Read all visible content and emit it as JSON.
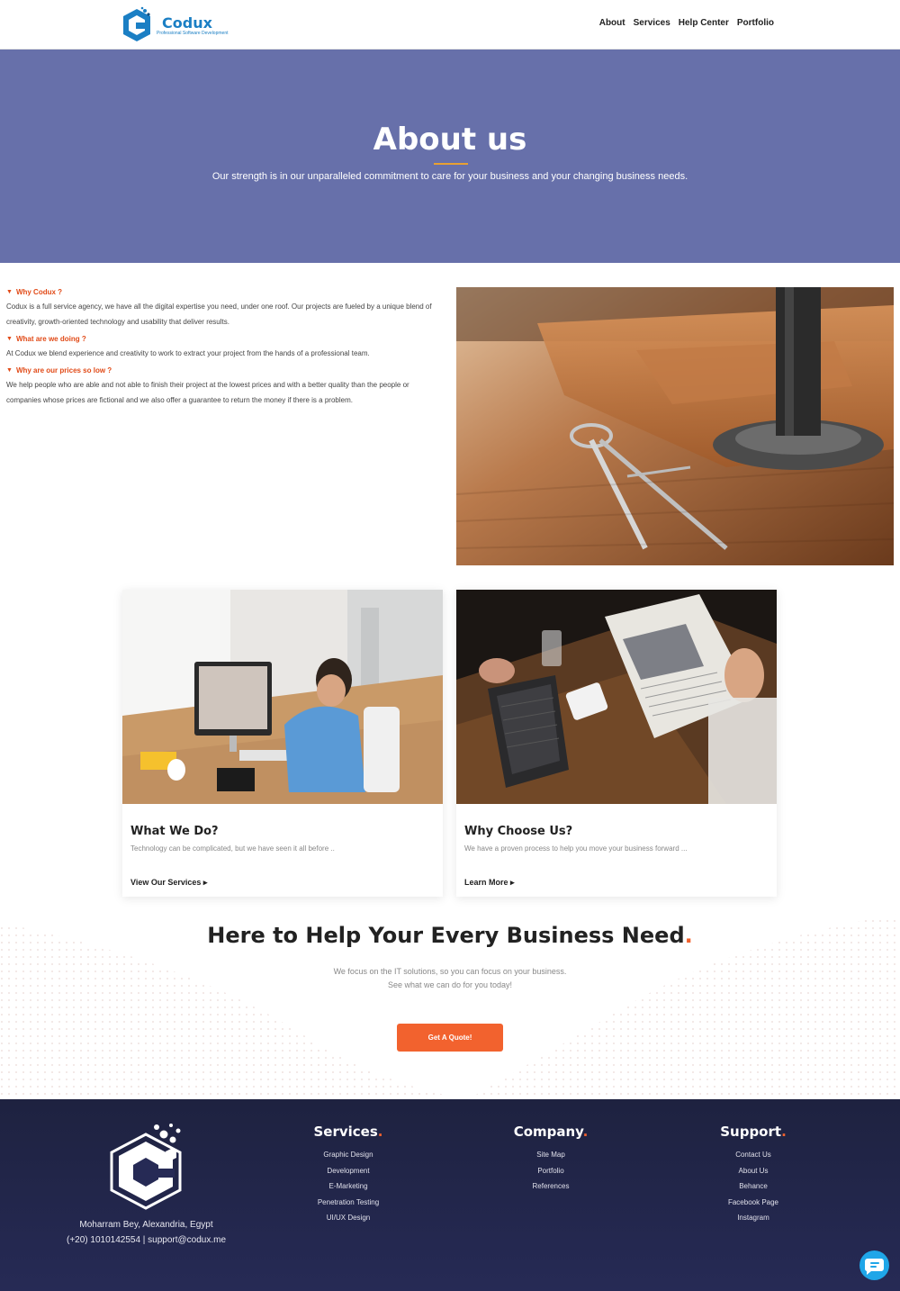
{
  "header": {
    "logo_name": "Codux",
    "logo_tagline": "Professional Software Development",
    "nav": [
      "About",
      "Services",
      "Help Center",
      "Portfolio"
    ]
  },
  "hero": {
    "title": "About us",
    "subtitle": "Our strength is in our unparalleled commitment to care for your business and your changing business needs."
  },
  "about": {
    "items": [
      {
        "q": "Why Codux ?",
        "a": "Codux is a full service agency, we have all the digital expertise you need, under one roof. Our projects are fueled by a unique blend of creativity, growth-oriented technology and usability that deliver results."
      },
      {
        "q": "What are we doing ?",
        "a": "At Codux we blend experience and creativity to work to extract your project from the hands of a professional team."
      },
      {
        "q": "Why are our prices so low ?",
        "a": "We help people who are able and not able to finish their project at the lowest prices and with a better quality than the people or companies whose prices are fictional and we also offer a guarantee to return the money if there is a problem."
      }
    ]
  },
  "cards": [
    {
      "title": "What We Do?",
      "desc": "Technology can be complicated, but we have seen it all before ..",
      "link": "View Our Services"
    },
    {
      "title": "Why Choose Us?",
      "desc": "We have a proven process to help you move your business forward ...",
      "link": "Learn More"
    }
  ],
  "help": {
    "title": "Here to Help Your Every Business Need",
    "title_dot": ".",
    "sub1": "We focus on the IT solutions, so you can focus on your business.",
    "sub2": "See what we can do for you today!",
    "button": "Get A Quote!"
  },
  "footer": {
    "address": "Moharram Bey, Alexandria, Egypt",
    "contact": "(+20) 1010142554 | support@codux.me",
    "columns": [
      {
        "title": "Services",
        "links": [
          "Graphic Design",
          "Development",
          "E-Marketing",
          "Penetration Testing",
          "UI/UX Design"
        ]
      },
      {
        "title": "Company",
        "links": [
          "Site Map",
          "Portfolio",
          "References"
        ]
      },
      {
        "title": "Support",
        "links": [
          "Contact Us",
          "About Us",
          "Behance",
          "Facebook Page",
          "Instagram"
        ]
      }
    ]
  },
  "colors": {
    "hero_bg": "#6770aa",
    "accent": "#f2622e",
    "question": "#e14a17",
    "footer_bg": "#1e2240",
    "brand_blue": "#1b7fc4",
    "chat": "#1fa6e8"
  },
  "icons": {
    "chat_button": "chat-icon",
    "question_marker": "caret-down-icon",
    "link_marker": "caret-right-icon"
  }
}
